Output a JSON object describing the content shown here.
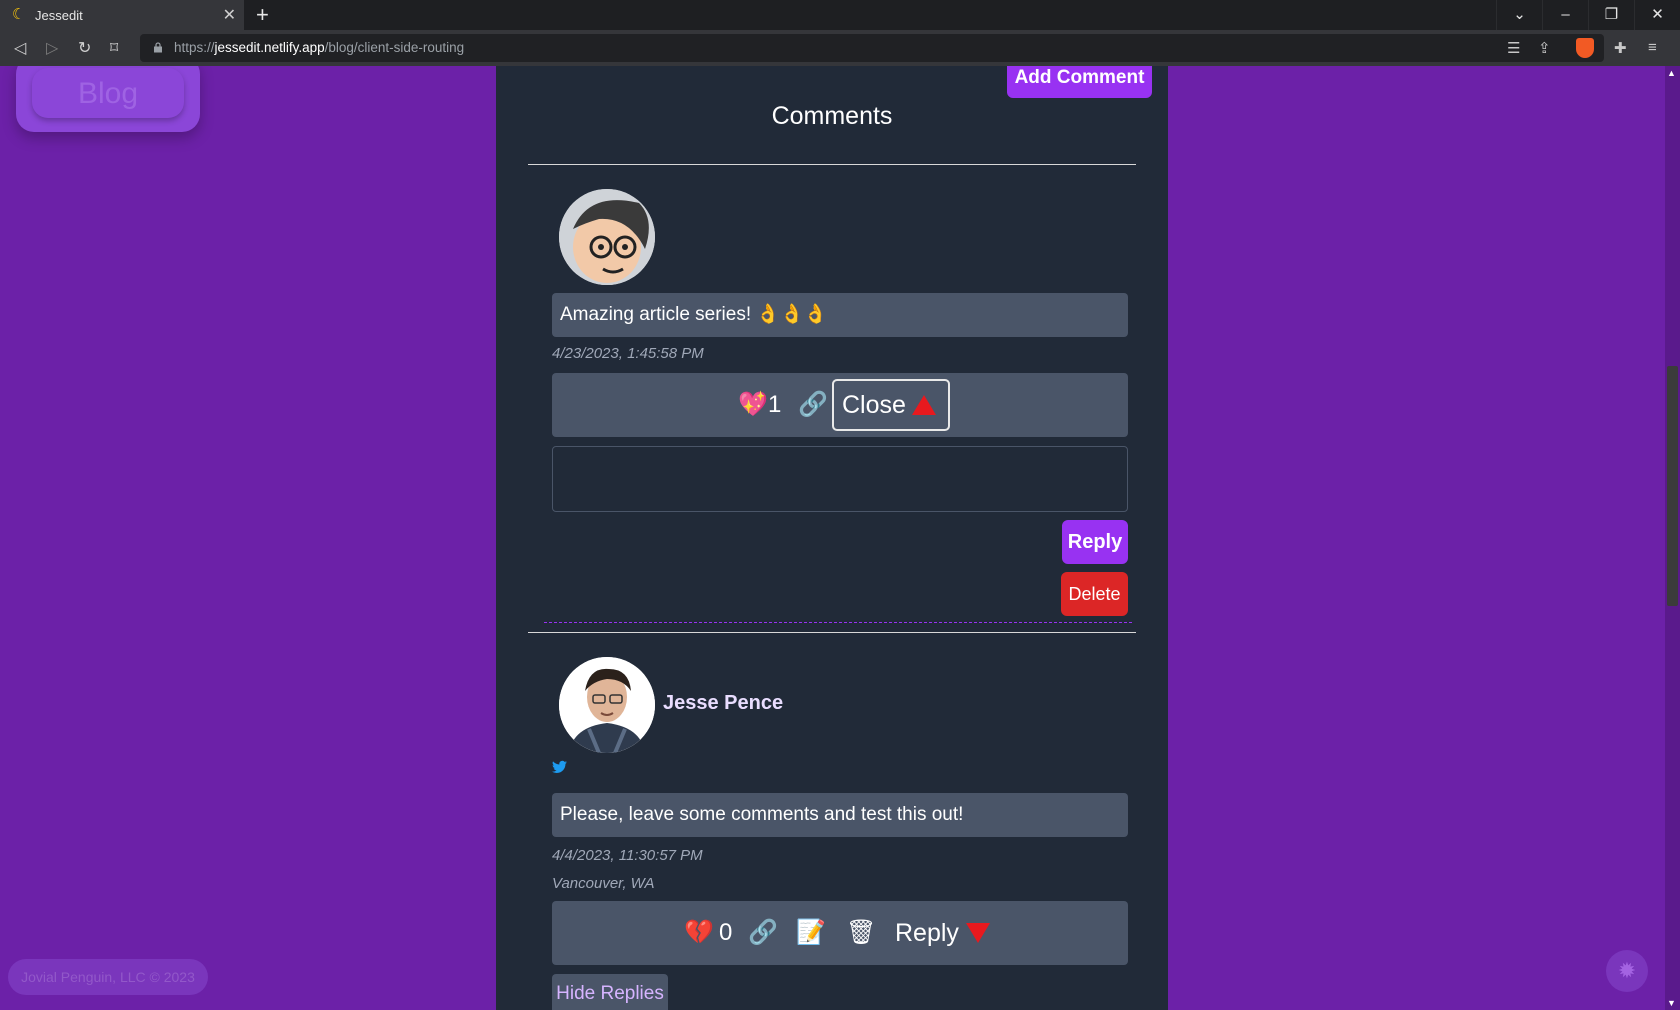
{
  "browser": {
    "tab_title": "Jessedit",
    "url_scheme": "https://",
    "url_host": "jessedit.netlify.app",
    "url_path": "/blog/client-side-routing"
  },
  "page": {
    "blog_label": "Blog",
    "add_comment_label": "Add Comment",
    "comments_heading": "Comments",
    "footer_text": "Jovial Penguin, LLC © 2023",
    "accent_color": "#9832f2",
    "background_color": "#6c21a8",
    "panel_color": "#212a38"
  },
  "comments": [
    {
      "text": "Amazing article series! 👌👌👌",
      "timestamp": "4/23/2023, 1:45:58 PM",
      "likes": "1",
      "close_label": "Close",
      "reply_textarea_value": "",
      "reply_button_label": "Reply",
      "delete_button_label": "Delete"
    },
    {
      "author": "Jesse Pence",
      "text": "Please, leave some comments and test this out!",
      "timestamp": "4/4/2023, 11:30:57 PM",
      "location": "Vancouver, WA",
      "likes": "0",
      "reply_label": "Reply",
      "hide_replies_label": "Hide Replies"
    }
  ]
}
